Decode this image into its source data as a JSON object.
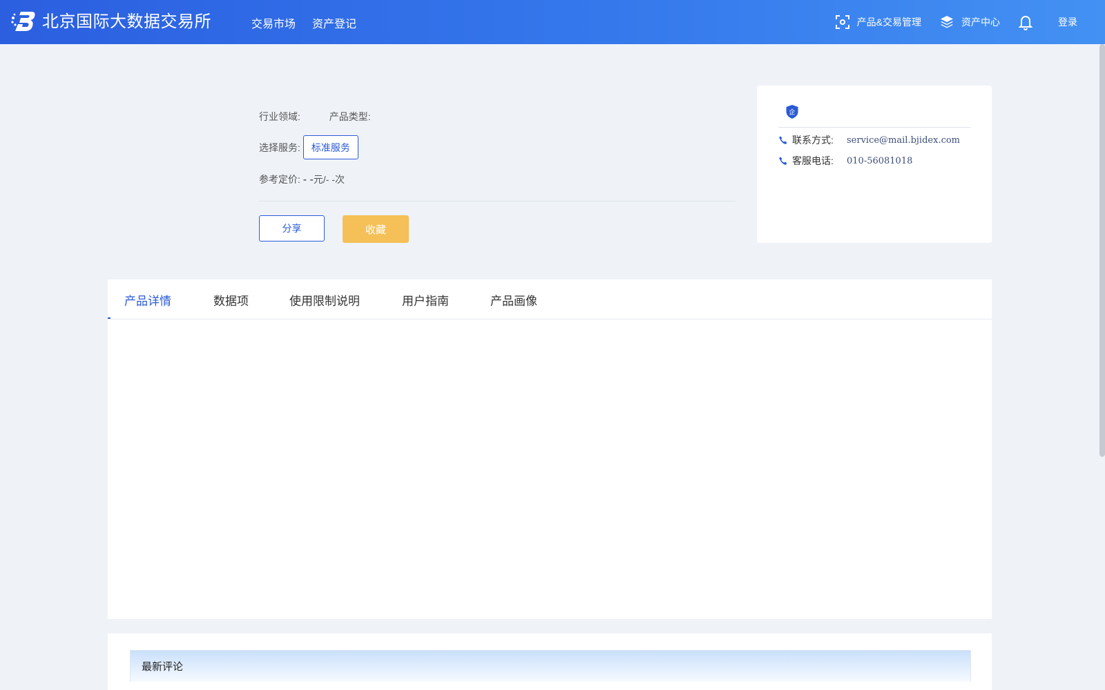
{
  "header": {
    "brand": "北京国际大数据交易所",
    "nav": [
      "交易市场",
      "资产登记"
    ],
    "right_nav": {
      "product_trade_mgmt": "产品&交易管理",
      "asset_center": "资产中心",
      "login": "登录"
    },
    "icons": [
      "logo-icon",
      "scan-icon",
      "layers-icon",
      "bell-icon"
    ]
  },
  "product": {
    "industry_label": "行业领域:",
    "type_label": "产品类型:",
    "service_label": "选择服务:",
    "service_option": "标准服务",
    "price_label": "参考定价:",
    "price_dash": "- -",
    "price_unit": "元/- -次",
    "share": "分享",
    "favorite": "收藏"
  },
  "contact": {
    "badge": "企",
    "contact_label": "联系方式:",
    "contact_value": "service@mail.bjidex.com",
    "phone_label": "客服电话:",
    "phone_value": "010-56081018"
  },
  "tabs": [
    "产品详情",
    "数据项",
    "使用限制说明",
    "用户指南",
    "产品画像"
  ],
  "active_tab": 0,
  "comments": {
    "title": "最新评论"
  },
  "colors": {
    "primary": "#2a5ad6",
    "header_start": "#2b5fe0",
    "header_end": "#4391f3",
    "favorite": "#f5c057",
    "background": "#eff3f8"
  }
}
